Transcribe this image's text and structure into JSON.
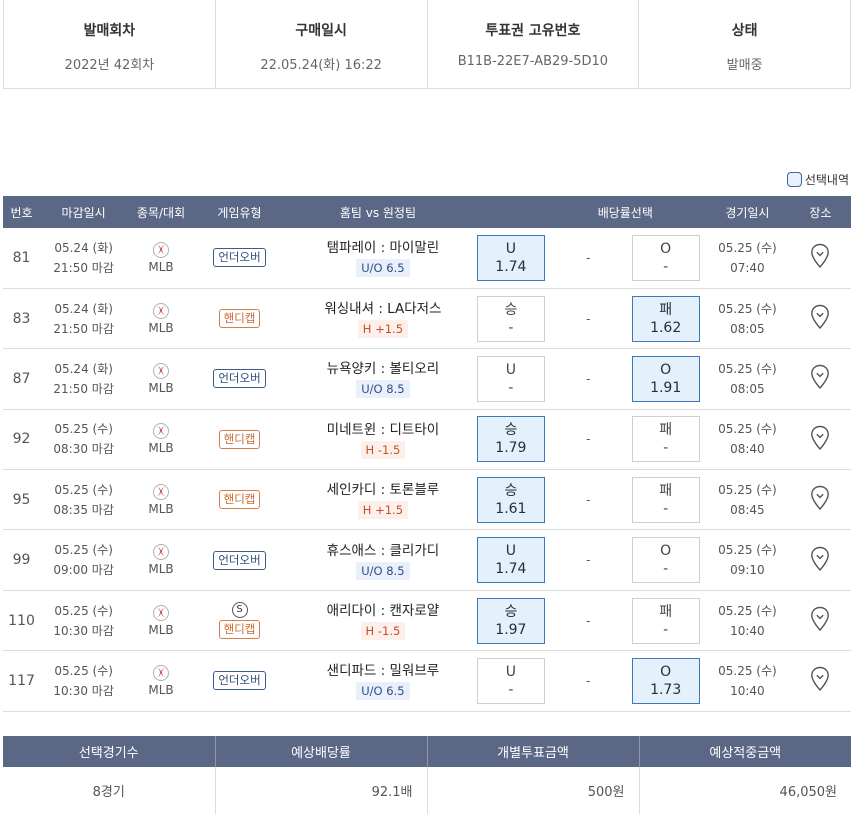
{
  "summary": [
    {
      "label": "발매회차",
      "value": "2022년 42회차"
    },
    {
      "label": "구매일시",
      "value": "22.05.24(화) 16:22"
    },
    {
      "label": "투표권 고유번호",
      "value": "B11B-22E7-AB29-5D10"
    },
    {
      "label": "상태",
      "value": "발매중"
    }
  ],
  "legend_label": "선택내역",
  "headers": [
    "번호",
    "마감일시",
    "종목/대회",
    "게임유형",
    "홈팀 vs 원정팀",
    "배당률선택",
    "경기일시",
    "장소"
  ],
  "rows": [
    {
      "no": "81",
      "close_date": "05.24 (화)",
      "close_time": "21:50 마감",
      "league": "MLB",
      "type": "언더오버",
      "kind": "uo",
      "special": "",
      "teams": "탬파레이 : 마이말린",
      "line": "U/O 6.5",
      "left_name": "U",
      "left_val": "1.74",
      "left_sel": true,
      "mid": "-",
      "right_name": "O",
      "right_val": "-",
      "right_sel": false,
      "game_date": "05.25 (수)",
      "game_time": "07:40"
    },
    {
      "no": "83",
      "close_date": "05.24 (화)",
      "close_time": "21:50 마감",
      "league": "MLB",
      "type": "핸디캡",
      "kind": "hd",
      "special": "",
      "teams": "워싱내셔 : LA다저스",
      "line": "H +1.5",
      "left_name": "승",
      "left_val": "-",
      "left_sel": false,
      "mid": "-",
      "right_name": "패",
      "right_val": "1.62",
      "right_sel": true,
      "game_date": "05.25 (수)",
      "game_time": "08:05"
    },
    {
      "no": "87",
      "close_date": "05.24 (화)",
      "close_time": "21:50 마감",
      "league": "MLB",
      "type": "언더오버",
      "kind": "uo",
      "special": "",
      "teams": "뉴욕양키 : 볼티오리",
      "line": "U/O 8.5",
      "left_name": "U",
      "left_val": "-",
      "left_sel": false,
      "mid": "-",
      "right_name": "O",
      "right_val": "1.91",
      "right_sel": true,
      "game_date": "05.25 (수)",
      "game_time": "08:05"
    },
    {
      "no": "92",
      "close_date": "05.25 (수)",
      "close_time": "08:30 마감",
      "league": "MLB",
      "type": "핸디캡",
      "kind": "hd",
      "special": "",
      "teams": "미네트윈 : 디트타이",
      "line": "H -1.5",
      "left_name": "승",
      "left_val": "1.79",
      "left_sel": true,
      "mid": "-",
      "right_name": "패",
      "right_val": "-",
      "right_sel": false,
      "game_date": "05.25 (수)",
      "game_time": "08:40"
    },
    {
      "no": "95",
      "close_date": "05.25 (수)",
      "close_time": "08:35 마감",
      "league": "MLB",
      "type": "핸디캡",
      "kind": "hd",
      "special": "",
      "teams": "세인카디 : 토론블루",
      "line": "H +1.5",
      "left_name": "승",
      "left_val": "1.61",
      "left_sel": true,
      "mid": "-",
      "right_name": "패",
      "right_val": "-",
      "right_sel": false,
      "game_date": "05.25 (수)",
      "game_time": "08:45"
    },
    {
      "no": "99",
      "close_date": "05.25 (수)",
      "close_time": "09:00 마감",
      "league": "MLB",
      "type": "언더오버",
      "kind": "uo",
      "special": "",
      "teams": "휴스애스 : 클리가디",
      "line": "U/O 8.5",
      "left_name": "U",
      "left_val": "1.74",
      "left_sel": true,
      "mid": "-",
      "right_name": "O",
      "right_val": "-",
      "right_sel": false,
      "game_date": "05.25 (수)",
      "game_time": "09:10"
    },
    {
      "no": "110",
      "close_date": "05.25 (수)",
      "close_time": "10:30 마감",
      "league": "MLB",
      "type": "핸디캡",
      "kind": "hd",
      "special": "S",
      "teams": "애리다이 : 캔자로얄",
      "line": "H -1.5",
      "left_name": "승",
      "left_val": "1.97",
      "left_sel": true,
      "mid": "-",
      "right_name": "패",
      "right_val": "-",
      "right_sel": false,
      "game_date": "05.25 (수)",
      "game_time": "10:40"
    },
    {
      "no": "117",
      "close_date": "05.25 (수)",
      "close_time": "10:30 마감",
      "league": "MLB",
      "type": "언더오버",
      "kind": "uo",
      "special": "",
      "teams": "샌디파드 : 밀워브루",
      "line": "U/O 6.5",
      "left_name": "U",
      "left_val": "-",
      "left_sel": false,
      "mid": "-",
      "right_name": "O",
      "right_val": "1.73",
      "right_sel": true,
      "game_date": "05.25 (수)",
      "game_time": "10:40"
    }
  ],
  "bottom": {
    "headers": [
      "선택경기수",
      "예상배당률",
      "개별투표금액",
      "예상적중금액"
    ],
    "values": [
      "8경기",
      "92.1배",
      "500원",
      "46,050원"
    ]
  },
  "colors": {
    "header_bg": "#5a6785",
    "selected_bg": "#e4f0fb",
    "selected_border": "#3d78b8",
    "handicap": "#c86a34",
    "underover": "#2f4c7c"
  }
}
